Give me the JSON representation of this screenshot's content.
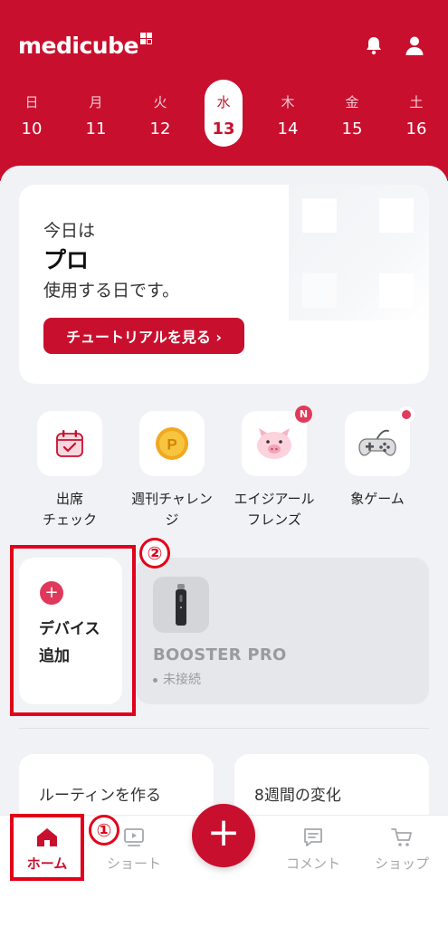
{
  "header": {
    "brand": "medicube",
    "accent_color": "#c8102e",
    "icons": [
      "bell-icon",
      "person-icon"
    ]
  },
  "week": [
    {
      "dow": "日",
      "date": "10",
      "active": false
    },
    {
      "dow": "月",
      "date": "11",
      "active": false
    },
    {
      "dow": "火",
      "date": "12",
      "active": false
    },
    {
      "dow": "水",
      "date": "13",
      "active": true
    },
    {
      "dow": "木",
      "date": "14",
      "active": false
    },
    {
      "dow": "金",
      "date": "15",
      "active": false
    },
    {
      "dow": "土",
      "date": "16",
      "active": false
    }
  ],
  "hero": {
    "line1": "今日は",
    "line2": "プロ",
    "line3": "使用する日です。",
    "button": "チュートリアルを見る ›"
  },
  "quick_items": [
    {
      "line1": "出席",
      "line2": "チェック",
      "icon": "calendar-check-icon"
    },
    {
      "line1": "週刊チャレン",
      "line2": "ジ",
      "icon": "coin-icon"
    },
    {
      "line1": "エイジアール",
      "line2": "フレンズ",
      "icon": "pig-icon",
      "badge": "N"
    },
    {
      "line1": "象ゲーム",
      "line2": "",
      "icon": "gamepad-icon",
      "badge_dot": true
    }
  ],
  "devices": {
    "add_label": "デバイス追加",
    "device_name": "BOOSTER PRO",
    "device_status": "未接続"
  },
  "cards": {
    "left": "ルーティンを作る",
    "right": "8週間の変化"
  },
  "tabbar": {
    "home": "ホーム",
    "short": "ショート",
    "comment": "コメント",
    "shop": "ショップ"
  },
  "annotations": {
    "one": "①",
    "two": "②",
    "color": "#e2001a"
  }
}
